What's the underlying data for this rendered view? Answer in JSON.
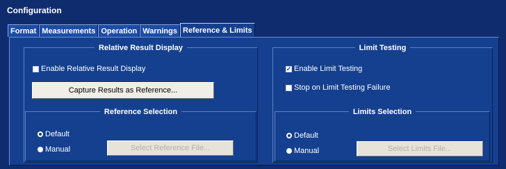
{
  "window": {
    "title": "Configuration"
  },
  "tabs": [
    {
      "label": "Format"
    },
    {
      "label": "Measurements"
    },
    {
      "label": "Operation"
    },
    {
      "label": "Warnings"
    },
    {
      "label": "Reference & Limits",
      "active": true
    }
  ],
  "relative_result": {
    "title": "Relative Result Display",
    "enable_label": "Enable Relative Result Display",
    "enable_checked": false,
    "capture_button": "Capture Results as Reference...",
    "reference_selection": {
      "title": "Reference Selection",
      "default_label": "Default",
      "manual_label": "Manual",
      "selected": "Default",
      "select_file_button": "Select Reference File..."
    }
  },
  "limit_testing": {
    "title": "Limit Testing",
    "enable_label": "Enable Limit Testing",
    "enable_checked": true,
    "stop_label": "Stop on Limit Testing Failure",
    "stop_checked": false,
    "limits_selection": {
      "title": "Limits Selection",
      "default_label": "Default",
      "manual_label": "Manual",
      "selected": "Default",
      "select_file_button": "Select Limits File..."
    }
  },
  "colors": {
    "background": "#0f2d6e",
    "panel": "#15408f",
    "tab": "#1c4ca8",
    "button": "#f0eee6",
    "text": "#ffffff"
  }
}
